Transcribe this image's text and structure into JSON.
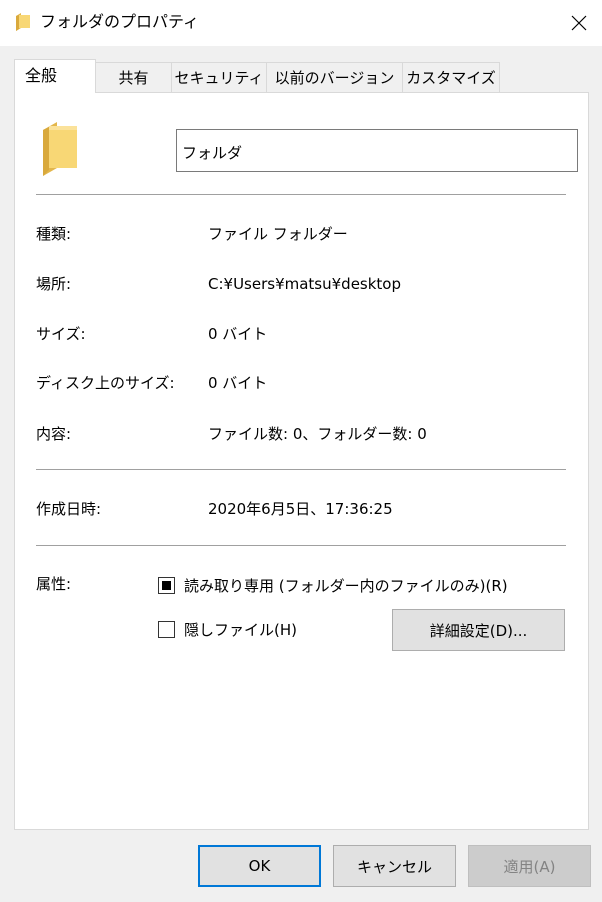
{
  "window": {
    "title": "フォルダのプロパティ",
    "icon": "folder-icon"
  },
  "tabs": [
    {
      "label": "全般",
      "active": true
    },
    {
      "label": "共有",
      "active": false
    },
    {
      "label": "セキュリティ",
      "active": false
    },
    {
      "label": "以前のバージョン",
      "active": false
    },
    {
      "label": "カスタマイズ",
      "active": false
    }
  ],
  "general": {
    "name_value": "フォルダ",
    "type_label": "種類:",
    "type_value": "ファイル フォルダー",
    "location_label": "場所:",
    "location_value": "C:¥Users¥matsu¥desktop",
    "size_label": "サイズ:",
    "size_value": "0 バイト",
    "disk_size_label": "ディスク上のサイズ:",
    "disk_size_value": "0 バイト",
    "contents_label": "内容:",
    "contents_value": "ファイル数: 0、フォルダー数: 0",
    "created_label": "作成日時:",
    "created_value": "2020年6月5日、17:36:25",
    "attributes_label": "属性:",
    "readonly_label": "読み取り専用 (フォルダー内のファイルのみ)(R)",
    "readonly_state": "indeterminate",
    "hidden_label": "隠しファイル(H)",
    "hidden_state": "unchecked",
    "advanced_label": "詳細設定(D)..."
  },
  "buttons": {
    "ok": "OK",
    "cancel": "キャンセル",
    "apply": "適用(A)"
  },
  "colors": {
    "folder": "#f8d775",
    "folder_shade": "#e3b64b",
    "accent": "#0078d7"
  }
}
